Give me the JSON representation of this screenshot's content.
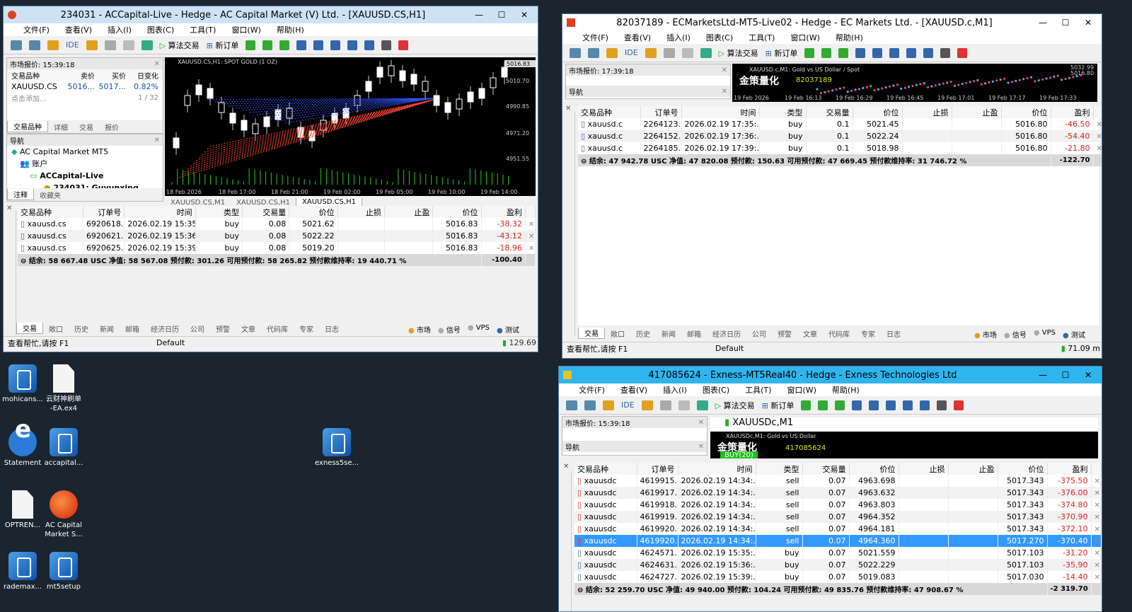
{
  "desktop": [
    {
      "label": "mohicans...",
      "icon": "installer-icon"
    },
    {
      "label": "云财神刷单\n-EA.ex4",
      "icon": "file-icon"
    },
    {
      "label": "Statement",
      "icon": "ie-icon"
    },
    {
      "label": "accapital...",
      "icon": "installer-icon"
    },
    {
      "label": "exness5se...",
      "icon": "installer-icon"
    },
    {
      "label": "OPTREN...",
      "icon": "file-icon"
    },
    {
      "label": "AC Capital\nMarket S...",
      "icon": "ac-icon"
    },
    {
      "label": "rademax...",
      "icon": "installer-icon"
    },
    {
      "label": "mt5setup",
      "icon": "installer-icon"
    }
  ],
  "menu": [
    "文件(F)",
    "查看(V)",
    "插入(I)",
    "图表(C)",
    "工具(T)",
    "窗口(W)",
    "帮助(H)"
  ],
  "toolbar": {
    "ide": "IDE",
    "algo": "算法交易",
    "new_order": "新订单"
  },
  "cols": [
    "交易品种",
    "订单号",
    "时间",
    "类型",
    "交易量",
    "价位",
    "止损",
    "止盈",
    "价位",
    "盈利"
  ],
  "bottom_tabs": [
    "交易",
    "敞口",
    "历史",
    "新闻",
    "邮箱",
    "经济日历",
    "公司",
    "预警",
    "文章",
    "代码库",
    "专家",
    "日志"
  ],
  "status_right": {
    "market": "市场",
    "signal": "信号",
    "vps": "VPS",
    "test": "测试"
  },
  "status_help": "查看帮忙,请按 F1",
  "status_default": "Default",
  "w1": {
    "title": "234031 - ACCapital-Live - Hedge - AC Capital Market (V) Ltd. - [XAUUSD.CS,H1]",
    "market_watch": "市场报价: 15:39:18",
    "mw_cols": [
      "交易品种",
      "卖价",
      "买价",
      "日变化"
    ],
    "mw_row": {
      "sym": "XAUUSD.CS",
      "bid": "5016...",
      "ask": "5017...",
      "chg": "0.82%"
    },
    "mw_add": "点击添加...",
    "mw_count": "1 / 32",
    "mw_tabs": [
      "交易品种",
      "详细",
      "交易",
      "报价"
    ],
    "nav_title": "导航",
    "nav": [
      "AC Capital Market MT5",
      "账户",
      "ACCapital-Live",
      "234031: Guyunxing"
    ],
    "nav_tabs": [
      "注释",
      "收藏夹"
    ],
    "chart_label": "XAUUSD.CS,H1: SPOT GOLD (1 OZ)",
    "price_ticks": [
      "5016.83",
      "5010.70",
      "4990.85",
      "4971.20",
      "4951.55"
    ],
    "time_ticks": [
      "18 Feb 2026",
      "18 Feb 17:00",
      "18 Feb 21:00",
      "19 Feb 02:00",
      "19 Feb 05:00",
      "19 Feb 10:00",
      "19 Feb 14:00"
    ],
    "chart_tabs": [
      "XAUUSD.CS,M1",
      "XAUUSD.CS,H1",
      "XAUUSD.CS,H1"
    ],
    "rows": [
      [
        "xauusd.cs",
        "6920618...",
        "2026.02.19 15:35:...",
        "buy",
        "0.08",
        "5021.62",
        "",
        "",
        "5016.83",
        "-38.32"
      ],
      [
        "xauusd.cs",
        "6920621...",
        "2026.02.19 15:36:...",
        "buy",
        "0.08",
        "5022.22",
        "",
        "",
        "5016.83",
        "-43.12"
      ],
      [
        "xauusd.cs",
        "6920625...",
        "2026.02.19 15:39:...",
        "buy",
        "0.08",
        "5019.20",
        "",
        "",
        "5016.83",
        "-18.96"
      ]
    ],
    "summary": "结余: 58 667.48 USC  净值: 58 567.08  预付款: 301.26  可用预付款: 58 265.82  预付款维持率: 19 440.71 %",
    "total": "-100.40",
    "ping": "129.69"
  },
  "w2": {
    "title": "82037189 - ECMarketsLtd-MT5-Live02 - Hedge - EC Markets Ltd. - [XAUUSD.c,M1]",
    "market_watch": "市场报价: 17:39:18",
    "nav_title": "导航",
    "chart_label": "XAUUSD.c,M1: Gold vs US Dollar / Spot",
    "banner": "金策量化",
    "acct": "82037189",
    "price_ticks": [
      "5032.99",
      "5016.80"
    ],
    "time_ticks": [
      "19 Feb 2026",
      "19 Feb 16:13",
      "19 Feb 16:29",
      "19 Feb 16:45",
      "19 Feb 17:01",
      "19 Feb 17:17",
      "19 Feb 17:33"
    ],
    "rows": [
      [
        "xauusd.c",
        "2264123...",
        "2026.02.19 17:35:...",
        "buy",
        "0.1",
        "5021.45",
        "",
        "",
        "5016.80",
        "-46.50"
      ],
      [
        "xauusd.c",
        "2264152...",
        "2026.02.19 17:36:...",
        "buy",
        "0.1",
        "5022.24",
        "",
        "",
        "5016.80",
        "-54.40"
      ],
      [
        "xauusd.c",
        "2264185...",
        "2026.02.19 17:39:...",
        "buy",
        "0.1",
        "5018.98",
        "",
        "",
        "5016.80",
        "-21.80"
      ]
    ],
    "summary": "结余: 47 942.78 USC  净值: 47 820.08  预付款: 150.63  可用预付款: 47 669.45  预付款维持率: 31 746.72 %",
    "total": "-122.70",
    "ping": "71.09 m"
  },
  "w3": {
    "title": "417085624 - Exness-MT5Real40 - Hedge - Exness Technologies Ltd",
    "market_watch": "市场报价: 15:39:18",
    "nav_title": "导航",
    "chart_tab": "XAUUSDc,M1",
    "chart_label": "XAUUSDc,M1: Gold vs US Dollar",
    "banner": "金策量化",
    "acct": "417085624",
    "badge": "BUY(20)",
    "rows": [
      [
        "xauusdc",
        "4619915...",
        "2026.02.19 14:34:...",
        "sell",
        "0.07",
        "4963.698",
        "",
        "",
        "5017.343",
        "-375.50"
      ],
      [
        "xauusdc",
        "4619917...",
        "2026.02.19 14:34:...",
        "sell",
        "0.07",
        "4963.632",
        "",
        "",
        "5017.343",
        "-376.00"
      ],
      [
        "xauusdc",
        "4619918...",
        "2026.02.19 14:34:...",
        "sell",
        "0.07",
        "4963.803",
        "",
        "",
        "5017.343",
        "-374.80"
      ],
      [
        "xauusdc",
        "4619919...",
        "2026.02.19 14:34:...",
        "sell",
        "0.07",
        "4964.352",
        "",
        "",
        "5017.343",
        "-370.90"
      ],
      [
        "xauusdc",
        "4619920...",
        "2026.02.19 14:34:...",
        "sell",
        "0.07",
        "4964.181",
        "",
        "",
        "5017.343",
        "-372.10"
      ],
      [
        "xauusdc",
        "4619920...",
        "2026.02.19 14:34:...",
        "sell",
        "0.07",
        "4964.360",
        "",
        "",
        "5017.270",
        "-370.40"
      ],
      [
        "xauusdc",
        "4624571...",
        "2026.02.19 15:35:...",
        "buy",
        "0.07",
        "5021.559",
        "",
        "",
        "5017.103",
        "-31.20"
      ],
      [
        "xauusdc",
        "4624631...",
        "2026.02.19 15:36:...",
        "buy",
        "0.07",
        "5022.229",
        "",
        "",
        "5017.103",
        "-35.90"
      ],
      [
        "xauusdc",
        "4624727...",
        "2026.02.19 15:39:...",
        "buy",
        "0.07",
        "5019.083",
        "",
        "",
        "5017.030",
        "-14.40"
      ]
    ],
    "selected_row": 5,
    "summary": "结余: 52 259.70 USC  净值: 49 940.00  预付款: 104.24  可用预付款: 49 835.76  预付款维持率: 47 908.67 %",
    "total": "-2 319.70"
  },
  "colors": {
    "w1_title": "#cde3f5",
    "w2_title": "#ffffff",
    "w3_title": "#2fb4ee",
    "loss": "#e02020",
    "select": "#3399ff"
  }
}
